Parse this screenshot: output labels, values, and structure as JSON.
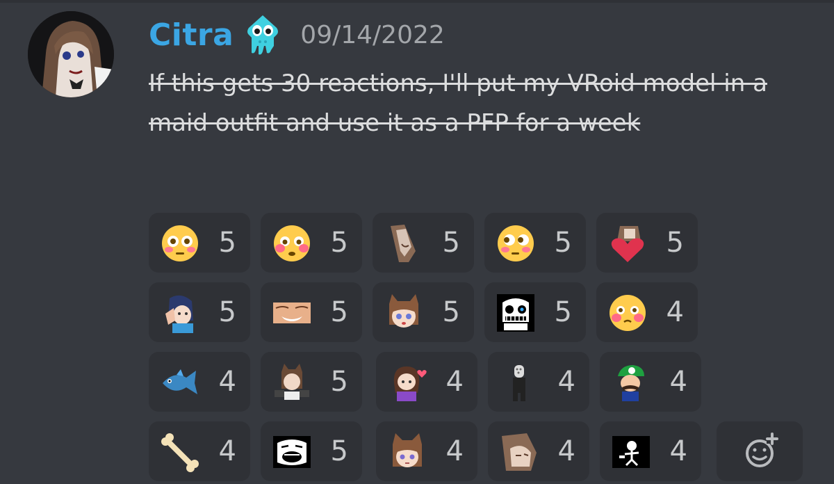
{
  "message": {
    "username": "Citra",
    "timestamp": "09/14/2022",
    "content": "If this gets 30 reactions, I'll put my VRoid model in a maid outfit and use it as a PFP for a week"
  },
  "reactions": [
    [
      {
        "icon": "flushed-face-icon",
        "count": "5"
      },
      {
        "icon": "blushing-flushed-face-icon",
        "count": "5"
      },
      {
        "icon": "anime-girl-peeking-icon",
        "count": "5"
      },
      {
        "icon": "flushed-face-side-eye-icon",
        "count": "5"
      },
      {
        "icon": "girl-heart-icon",
        "count": "5"
      }
    ],
    [
      {
        "icon": "anime-girl-headscratch-icon",
        "count": "5"
      },
      {
        "icon": "smug-face-closeup-icon",
        "count": "5"
      },
      {
        "icon": "anime-catgirl-worried-icon",
        "count": "5"
      },
      {
        "icon": "sans-skull-icon",
        "count": "5"
      },
      {
        "icon": "blushing-face-icon",
        "count": "4"
      }
    ],
    [
      {
        "icon": "blue-fish-icon",
        "count": "4"
      },
      {
        "icon": "catgirl-dumbbells-icon",
        "count": "5"
      },
      {
        "icon": "chibi-girl-heart-icon",
        "count": "4"
      },
      {
        "icon": "crocs-person-icon",
        "count": "4"
      },
      {
        "icon": "luigi-icon",
        "count": "4"
      }
    ],
    [
      {
        "icon": "bone-icon",
        "count": "4"
      },
      {
        "icon": "trollface-screaming-icon",
        "count": "5"
      },
      {
        "icon": "anime-catgirl-neutral-icon",
        "count": "4"
      },
      {
        "icon": "anime-girl-sleepy-icon",
        "count": "4"
      },
      {
        "icon": "dancing-skeleton-icon",
        "count": "4"
      }
    ]
  ],
  "add_reaction_icon": "add-reaction-icon",
  "colors": {
    "background": "#36393f",
    "reaction_bg": "#2f3136",
    "username": "#3ba6e4",
    "timestamp": "#a3a6aa",
    "text": "#dcddde",
    "count": "#c7c9cb"
  }
}
